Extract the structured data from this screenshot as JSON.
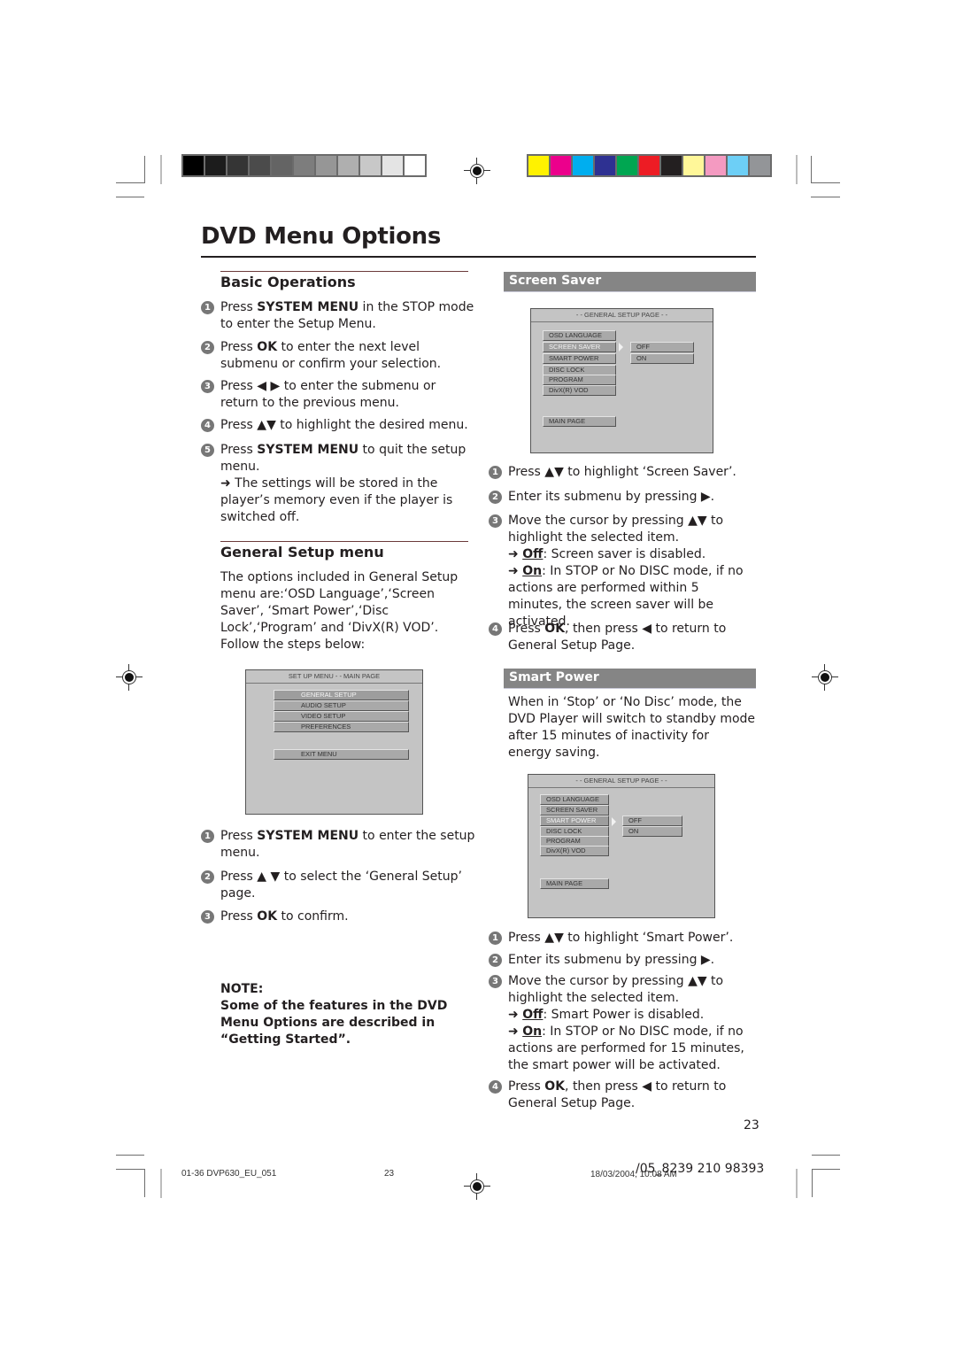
{
  "page": {
    "title": "DVD Menu Options",
    "page_number": "23"
  },
  "colors": {
    "gray_bar": [
      "#000000",
      "#1c1c1c",
      "#353535",
      "#4b4b4b",
      "#646464",
      "#7d7d7d",
      "#969696",
      "#afafaf",
      "#c8c8c8",
      "#e4e4e4",
      "#ffffff"
    ],
    "color_bar": [
      "#fff200",
      "#ec008c",
      "#00aeef",
      "#2e3192",
      "#00a651",
      "#ed1c24",
      "#231f20",
      "#fff799",
      "#f49ac1",
      "#6dcff6",
      "#939598"
    ],
    "section_band": "#858585"
  },
  "basic_operations": {
    "heading": "Basic Operations",
    "steps": [
      {
        "num": "1",
        "pre": "Press ",
        "bold": "SYSTEM MENU",
        "post": " in the STOP mode to enter the Setup Menu."
      },
      {
        "num": "2",
        "pre": "Press ",
        "bold": "OK",
        "post": " to enter the next level submenu or confirm your selection."
      },
      {
        "num": "3",
        "text": "Press ◀ ▶  to enter the submenu or return to the previous menu."
      },
      {
        "num": "4",
        "text": "Press ▲▼ to highlight the desired menu."
      },
      {
        "num": "5",
        "pre": "Press ",
        "bold": "SYSTEM MENU",
        "post": " to quit the setup menu.",
        "result": "➜ The settings will be stored in the player’s memory even if the player is switched off."
      }
    ]
  },
  "general_setup": {
    "heading": "General Setup menu",
    "intro": "The options included in General Setup menu are:‘OSD Language’,‘Screen Saver’, ‘Smart Power’,‘Disc Lock’,‘Program’ and ‘DivX(R) VOD’.",
    "follow": "Follow the steps below:",
    "osd": {
      "title": "SET UP MENU - - MAIN PAGE",
      "items": [
        "GENERAL SETUP",
        "AUDIO SETUP",
        "VIDEO SETUP",
        "PREFERENCES"
      ],
      "selected": "GENERAL SETUP",
      "exit": "EXIT MENU"
    },
    "steps": [
      {
        "num": "1",
        "pre": "Press ",
        "bold": "SYSTEM MENU",
        "post": " to enter the setup menu."
      },
      {
        "num": "2",
        "text": "Press ▲ ▼ to select the ‘General Setup’ page."
      },
      {
        "num": "3",
        "pre": "Press ",
        "bold": "OK",
        "post": " to confirm."
      }
    ]
  },
  "note": {
    "label": "NOTE:",
    "text": "Some of the features in the DVD Menu Options are described in “Getting Started”."
  },
  "screen_saver": {
    "heading": "Screen Saver",
    "osd": {
      "title": "- - GENERAL SETUP PAGE - -",
      "items": [
        "OSD LANGUAGE",
        "SCREEN SAVER",
        "SMART POWER",
        "DISC LOCK",
        "PROGRAM",
        "DivX(R) VOD"
      ],
      "selected": "SCREEN SAVER",
      "options": [
        "OFF",
        "ON"
      ],
      "main_page": "MAIN PAGE"
    },
    "steps": [
      {
        "num": "1",
        "text": "Press ▲▼ to highlight ‘Screen Saver’."
      },
      {
        "num": "2",
        "text": "Enter its submenu by pressing ▶."
      },
      {
        "num": "3",
        "text": "Move the cursor by pressing ▲▼ to highlight the selected item.",
        "off_label": "Off",
        "off_text": ": Screen saver is disabled.",
        "on_label": "On",
        "on_text": ": In STOP or No DISC mode, if no actions are performed within 5 minutes, the screen saver will be activated."
      },
      {
        "num": "4",
        "pre": "Press ",
        "bold": "OK",
        "post": ", then press ◀ to return to General Setup Page."
      }
    ]
  },
  "smart_power": {
    "heading": "Smart Power",
    "intro": "When in ‘Stop’ or ‘No Disc’ mode, the DVD Player will switch to standby mode after 15 minutes of inactivity for energy saving.",
    "osd": {
      "title": "- - GENERAL SETUP PAGE - -",
      "items": [
        "OSD LANGUAGE",
        "SCREEN SAVER",
        "SMART POWER",
        "DISC LOCK",
        "PROGRAM",
        "DivX(R) VOD"
      ],
      "selected": "SMART POWER",
      "options": [
        "OFF",
        "ON"
      ],
      "main_page": "MAIN PAGE"
    },
    "steps": [
      {
        "num": "1",
        "text": "Press ▲▼ to highlight ‘Smart Power’."
      },
      {
        "num": "2",
        "text": "Enter its submenu by pressing ▶."
      },
      {
        "num": "3",
        "text": "Move the cursor by pressing ▲▼ to highlight the selected item.",
        "off_label": "Off",
        "off_text": ": Smart Power is disabled.",
        "on_label": "On",
        "on_text": ": In STOP or No DISC mode, if no actions are performed for 15 minutes, the smart power will be activated."
      },
      {
        "num": "4",
        "pre": "Press ",
        "bold": "OK",
        "post": ", then press ◀ to return to General Setup Page."
      }
    ]
  },
  "footer": {
    "file": "01-36 DVP630_EU_051",
    "page": "23",
    "date": "18/03/2004, 10:08 AM",
    "code": "/05_8239 210 98393"
  }
}
